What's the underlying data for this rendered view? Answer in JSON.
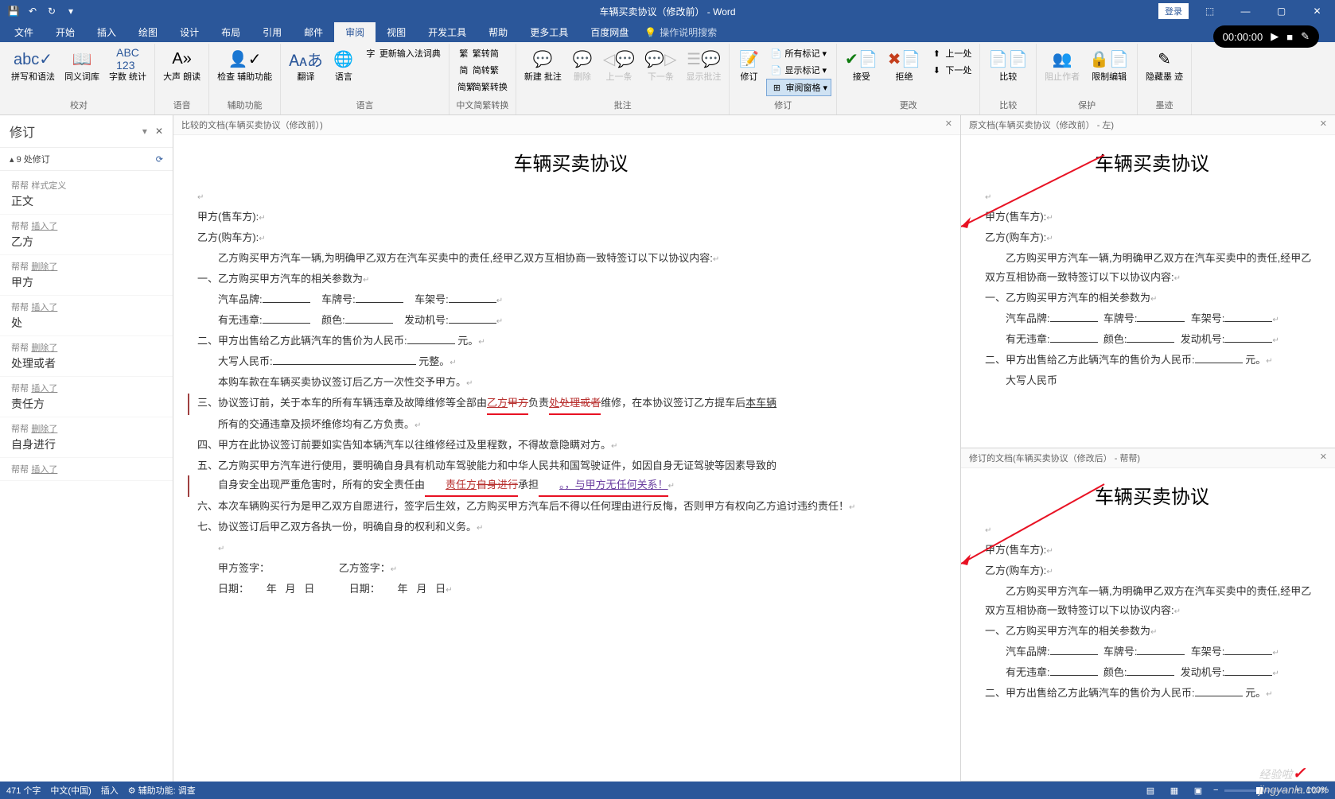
{
  "app": {
    "title": "车辆买卖协议（修改前） - Word",
    "login": "登录"
  },
  "recorder": {
    "time": "00:00:00"
  },
  "tabs": {
    "file": "文件",
    "home": "开始",
    "insert": "插入",
    "draw": "绘图",
    "design": "设计",
    "layout": "布局",
    "references": "引用",
    "mail": "邮件",
    "review": "审阅",
    "view": "视图",
    "devtools": "开发工具",
    "help": "帮助",
    "more": "更多工具",
    "baidu": "百度网盘",
    "tellme": "操作说明搜索"
  },
  "ribbon": {
    "proofing": {
      "spell": "拼写和语法",
      "thesaurus": "同义词库",
      "wordcount": "字数\n统计",
      "label": "校对"
    },
    "speech": {
      "aloud": "大声\n朗读",
      "label": "语音"
    },
    "a11y": {
      "check": "检查\n辅助功能",
      "label": "辅助功能"
    },
    "language": {
      "translate": "翻译",
      "lang": "语言",
      "update": "更新输入法词典",
      "label": "语言"
    },
    "convert": {
      "s2t": "繁转简",
      "t2s": "简转繁",
      "st": "简繁转换",
      "label": "中文简繁转换"
    },
    "comments": {
      "new": "新建\n批注",
      "delete": "删除",
      "prev": "上一条",
      "next": "下一条",
      "show": "显示批注",
      "label": "批注"
    },
    "tracking": {
      "track": "修订",
      "all": "所有标记",
      "markup": "显示标记",
      "pane": "审阅窗格",
      "label": "修订"
    },
    "changes": {
      "accept": "接受",
      "reject": "拒绝",
      "prev": "上一处",
      "next": "下一处",
      "label": "更改"
    },
    "compare": {
      "compare": "比较",
      "label": "比较"
    },
    "protect": {
      "block": "阻止作者",
      "restrict": "限制编辑",
      "label": "保护"
    },
    "ink": {
      "hide": "隐藏墨\n迹",
      "label": "墨迹"
    }
  },
  "revpane": {
    "title": "修订",
    "count": "9 处修订",
    "items": [
      {
        "author": "帮帮",
        "action": "样式定义",
        "content": "正文"
      },
      {
        "author": "帮帮",
        "action": "插入了",
        "content": "乙方"
      },
      {
        "author": "帮帮",
        "action": "删除了",
        "content": "甲方"
      },
      {
        "author": "帮帮",
        "action": "插入了",
        "content": "处"
      },
      {
        "author": "帮帮",
        "action": "删除了",
        "content": "处理或者"
      },
      {
        "author": "帮帮",
        "action": "插入了",
        "content": "责任方"
      },
      {
        "author": "帮帮",
        "action": "删除了",
        "content": "自身进行"
      },
      {
        "author": "帮帮",
        "action": "插入了",
        "content": ""
      }
    ]
  },
  "compare": {
    "header": "比较的文档(车辆买卖协议（修改前）)",
    "title": "车辆买卖协议",
    "p1a": "甲方(售车方):",
    "p1b": "乙方(购车方):",
    "p2": "乙方购买甲方汽车一辆,为明确甲乙双方在汽车买卖中的责任,经甲乙双方互相协商一致特签订以下以协议内容:",
    "p3": "一、乙方购买甲方汽车的相关参数为",
    "p4a": "汽车品牌:",
    "p4b": "车牌号:",
    "p4c": "车架号:",
    "p5a": "有无违章:",
    "p5b": "颜色:",
    "p5c": "发动机号:",
    "p6a": "二、甲方出售给乙方此辆汽车的售价为人民币:",
    "p6b": "元。",
    "p7a": "大写人民币:",
    "p7b": "元整。",
    "p8": "本购车款在车辆买卖协议签订后乙方一次性交予甲方。",
    "p9a": "三、协议签订前，关于本车的所有车辆违章及故障维修等全部由",
    "p9b": "乙方",
    "p9c": "甲方",
    "p9d": "负责",
    "p9e": "处",
    "p9f": "处理或者",
    "p9g": "维修，在本协议签订乙方提车后",
    "p9h": "本车辆",
    "p10": "所有的交通违章及损坏维修均有乙方负责。",
    "p11": "四、甲方在此协议签订前要如实告知本辆汽车以往维修经过及里程数，不得故意隐瞒对方。",
    "p12": "五、乙方购买甲方汽车进行使用，要明确自身具有机动车驾驶能力和中华人民共和国驾驶证件，如因自身无证驾驶等因素导致的",
    "p13a": "自身安全出现严重危害时，所有的安全责任由",
    "p13b": "责任方",
    "p13c": "自身进行",
    "p13d": "承担",
    "p13e": "。",
    "p13f": "，与甲方无任何关系！",
    "p14": "六、本次车辆购买行为是甲乙双方自愿进行，签字后生效，乙方购买甲方汽车后不得以任何理由进行反悔，否则甲方有权向乙方追讨违约责任！",
    "p15": "七、协议签订后甲乙双方各执一份，明确自身的权利和义务。",
    "p16a": "甲方签字：",
    "p16b": "乙方签字：",
    "p17a": "日期：",
    "p17b": "年",
    "p17c": "月",
    "p17d": "日"
  },
  "original": {
    "header": "原文档(车辆买卖协议（修改前） - 左)",
    "title": "车辆买卖协议",
    "p2": "乙方购买甲方汽车一辆,为明确甲乙双方在汽车买卖中的责任,经甲乙双方互相协商一致特签订以下以协议内容:",
    "foot": "大写人民币"
  },
  "revised": {
    "header": "修订的文档(车辆买卖协议（修改后） - 帮帮)",
    "title": "车辆买卖协议",
    "p3b": "一、乙方购买甲方汽车的相关参数为"
  },
  "status": {
    "words": "471 个字",
    "lang": "中文(中国)",
    "insert": "插入",
    "a11y": "辅助功能: 调查",
    "zoom": "100%"
  },
  "watermark": "jingyanla.com",
  "watermark_pre": "经验啦"
}
